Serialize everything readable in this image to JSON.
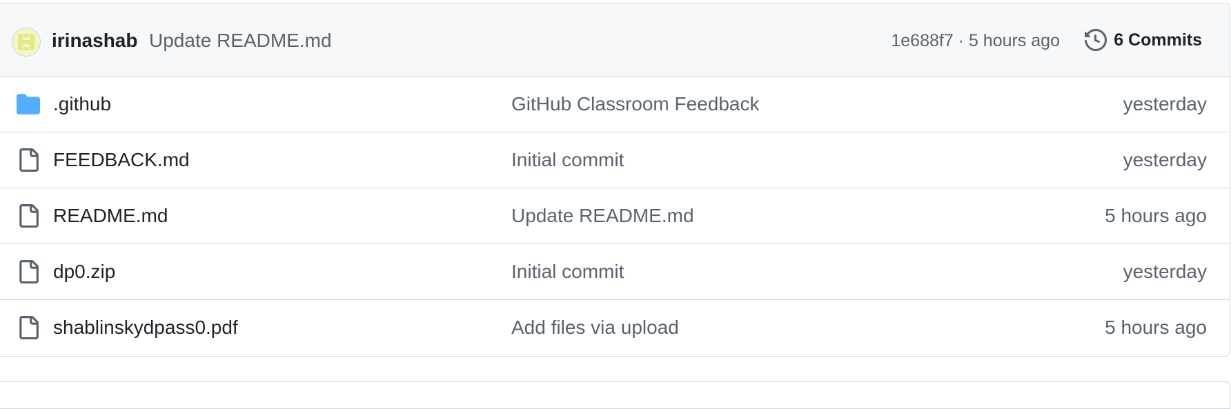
{
  "latest_commit": {
    "author": "irinashab",
    "message": "Update README.md",
    "meta": "1e688f7 · 5 hours ago",
    "commits_label": "6 Commits",
    "avatar_icon": "identicon-avatar",
    "history_icon": "history-icon"
  },
  "files": [
    {
      "name": ".github",
      "type": "folder",
      "icon": "folder-icon",
      "message": "GitHub Classroom Feedback",
      "date": "yesterday"
    },
    {
      "name": "FEEDBACK.md",
      "type": "file",
      "icon": "file-icon",
      "message": "Initial commit",
      "date": "yesterday"
    },
    {
      "name": "README.md",
      "type": "file",
      "icon": "file-icon",
      "message": "Update README.md",
      "date": "5 hours ago"
    },
    {
      "name": "dp0.zip",
      "type": "file",
      "icon": "file-icon",
      "message": "Initial commit",
      "date": "yesterday"
    },
    {
      "name": "shablinskydpass0.pdf",
      "type": "file",
      "icon": "file-icon",
      "message": "Add files via upload",
      "date": "5 hours ago"
    }
  ],
  "colors": {
    "folder": "#54aeff",
    "file_icon": "#59636e",
    "header_bg": "#f6f8fa",
    "border": "#d0d7de",
    "avatar_bg": "#f4f6c4",
    "avatar_fg": "#e3e88a"
  }
}
